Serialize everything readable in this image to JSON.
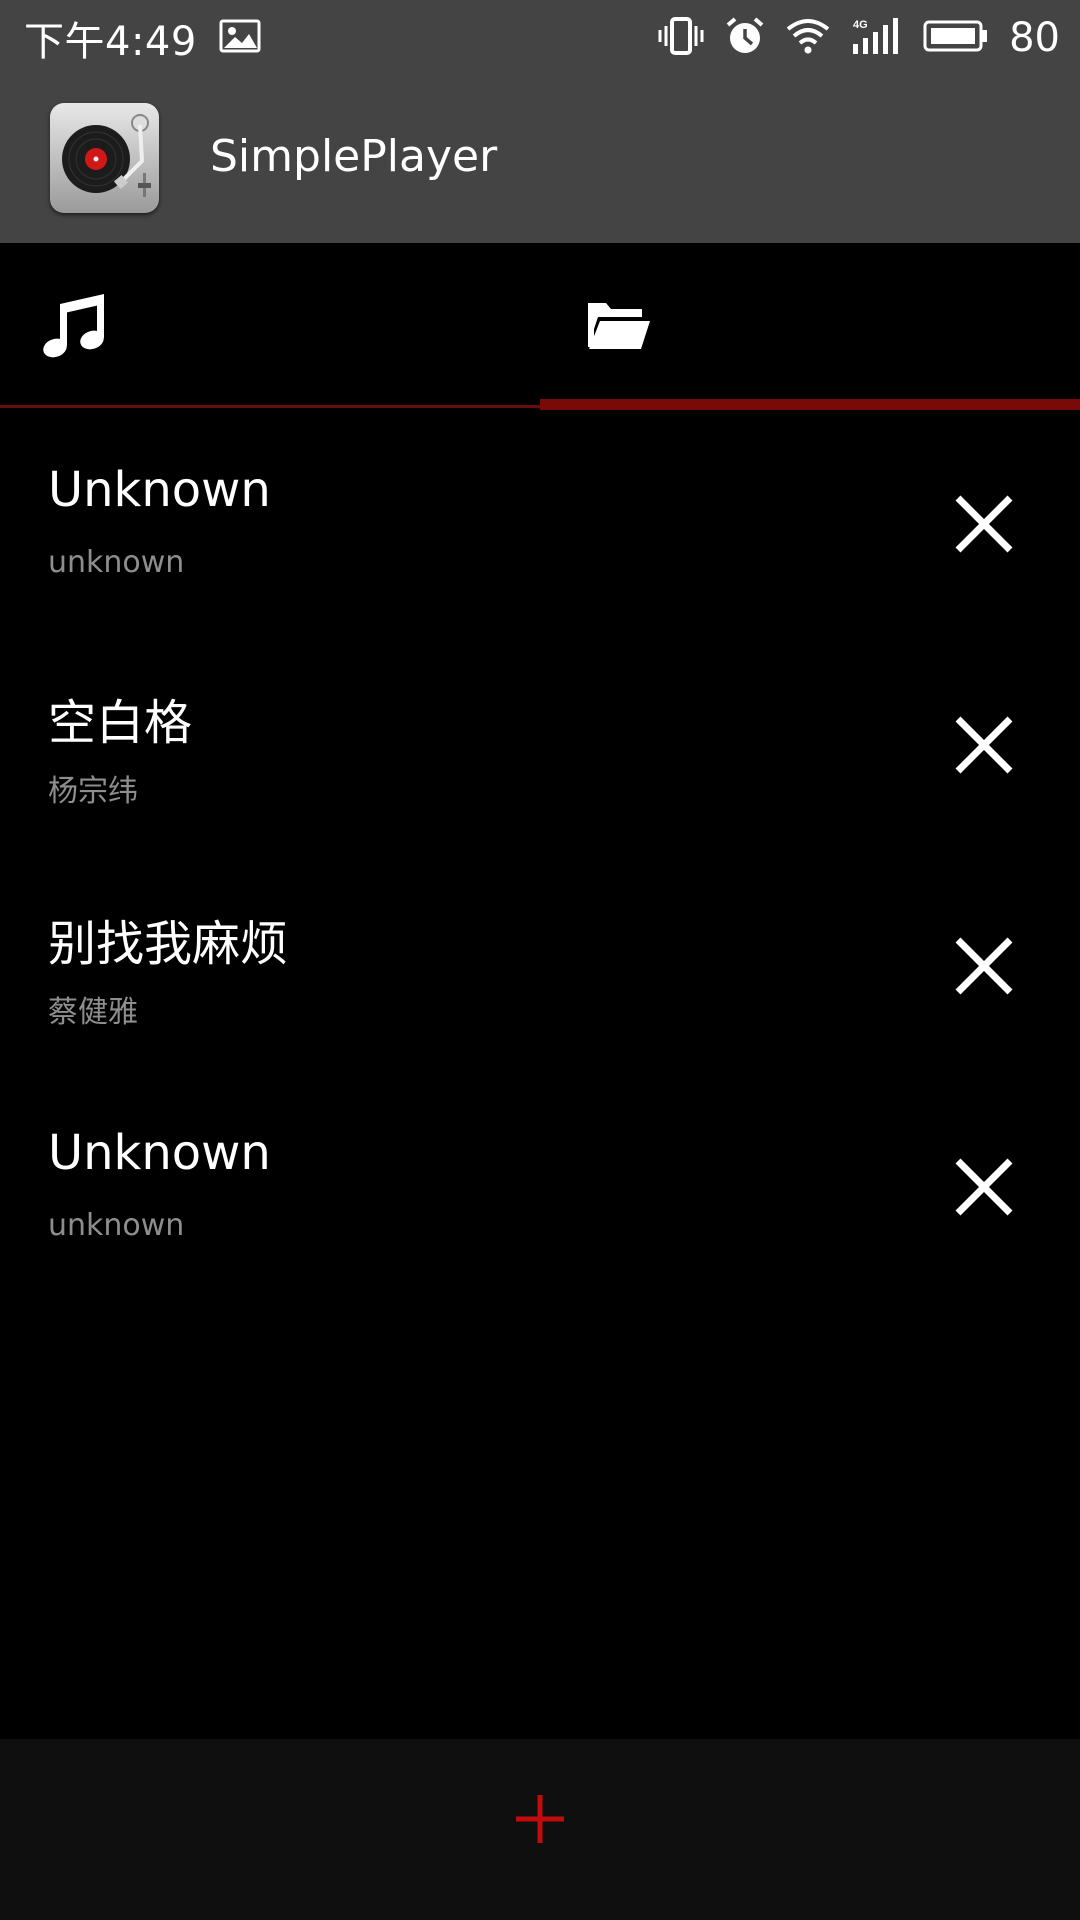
{
  "status_bar": {
    "time": "下午4:49",
    "battery": "80",
    "icons": [
      "image-icon",
      "vibrate-icon",
      "alarm-icon",
      "wifi-icon",
      "signal-4g-icon",
      "battery-icon"
    ]
  },
  "app_bar": {
    "title": "SimplePlayer",
    "icon": "turntable-icon"
  },
  "tabs": [
    {
      "icon": "music-note-icon",
      "selected": false
    },
    {
      "icon": "folder-open-icon",
      "selected": true
    }
  ],
  "songs": [
    {
      "title": "Unknown",
      "artist": "unknown"
    },
    {
      "title": "空白格",
      "artist": "杨宗纬"
    },
    {
      "title": "别找我麻烦",
      "artist": "蔡健雅"
    },
    {
      "title": "Unknown",
      "artist": "unknown"
    }
  ],
  "actions": {
    "remove_icon": "close-icon",
    "add_icon": "plus-icon"
  },
  "colors": {
    "bar_bg": "#444444",
    "accent": "#7a0a0a",
    "add_red": "#c20b0b",
    "artist_gray": "#8e8e8e",
    "bottom_bg": "#0f0f0f"
  }
}
